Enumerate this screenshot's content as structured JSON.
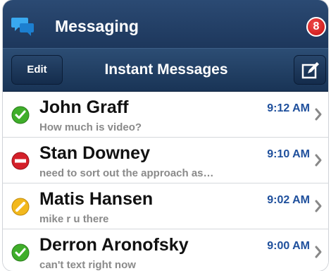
{
  "app": {
    "title": "Messaging",
    "badge_count": "8"
  },
  "nav": {
    "edit_label": "Edit",
    "title": "Instant Messages"
  },
  "conversations": [
    {
      "name": "John Graff",
      "preview": "How much is video?",
      "time": "9:12 AM",
      "status": "available"
    },
    {
      "name": "Stan Downey",
      "preview": "need to sort out the approach as…",
      "time": "9:10 AM",
      "status": "busy"
    },
    {
      "name": "Matis Hansen",
      "preview": "mike r u there",
      "time": "9:02 AM",
      "status": "away"
    },
    {
      "name": "Derron Aronofsky",
      "preview": "can't text right now",
      "time": "9:00 AM",
      "status": "available"
    }
  ],
  "colors": {
    "available": "#3fae2a",
    "busy": "#d4202a",
    "away": "#f2b81d",
    "time": "#1e4f9c"
  }
}
